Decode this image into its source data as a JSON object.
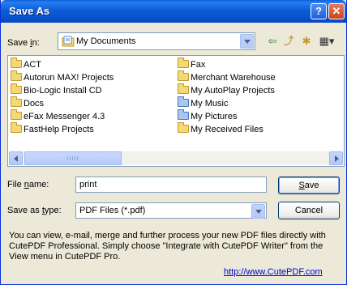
{
  "window": {
    "title": "Save As"
  },
  "titlebar_buttons": {
    "help": "?",
    "close": "✕"
  },
  "save_in": {
    "label_prefix": "Save ",
    "label_key": "i",
    "label_suffix": "n:",
    "value": "My Documents"
  },
  "toolbar": {
    "back": "⇦",
    "up": "⤴",
    "new_folder": "✱",
    "views": "▦▾"
  },
  "files": [
    {
      "name": "ACT",
      "col": 0,
      "row": 0,
      "type": "folder"
    },
    {
      "name": "Autorun MAX! Projects",
      "col": 0,
      "row": 1,
      "type": "folder"
    },
    {
      "name": "Bio-Logic Install CD",
      "col": 0,
      "row": 2,
      "type": "folder"
    },
    {
      "name": "Docs",
      "col": 0,
      "row": 3,
      "type": "folder"
    },
    {
      "name": "eFax Messenger 4.3",
      "col": 0,
      "row": 4,
      "type": "folder"
    },
    {
      "name": "FastHelp Projects",
      "col": 0,
      "row": 5,
      "type": "folder"
    },
    {
      "name": "Fax",
      "col": 1,
      "row": 0,
      "type": "folder"
    },
    {
      "name": "Merchant Warehouse",
      "col": 1,
      "row": 1,
      "type": "folder"
    },
    {
      "name": "My AutoPlay Projects",
      "col": 1,
      "row": 2,
      "type": "folder"
    },
    {
      "name": "My Music",
      "col": 1,
      "row": 3,
      "type": "special-folder"
    },
    {
      "name": "My Pictures",
      "col": 1,
      "row": 4,
      "type": "special-folder"
    },
    {
      "name": "My Received Files",
      "col": 1,
      "row": 5,
      "type": "folder"
    }
  ],
  "file_name": {
    "label_prefix": "File ",
    "label_key": "n",
    "label_suffix": "ame:",
    "value": "print"
  },
  "save_as_type": {
    "label_prefix": "Save as ",
    "label_key": "t",
    "label_suffix": "ype:",
    "value": "PDF Files (*.pdf)"
  },
  "buttons": {
    "save_key": "S",
    "save_rest": "ave",
    "cancel": "Cancel"
  },
  "hint": "You can view, e-mail, merge and further process your new PDF files directly with CutePDF Professional. Simply choose \"Integrate with CutePDF Writer\" from the View menu in CutePDF Pro.",
  "link": "http://www.CutePDF.com"
}
